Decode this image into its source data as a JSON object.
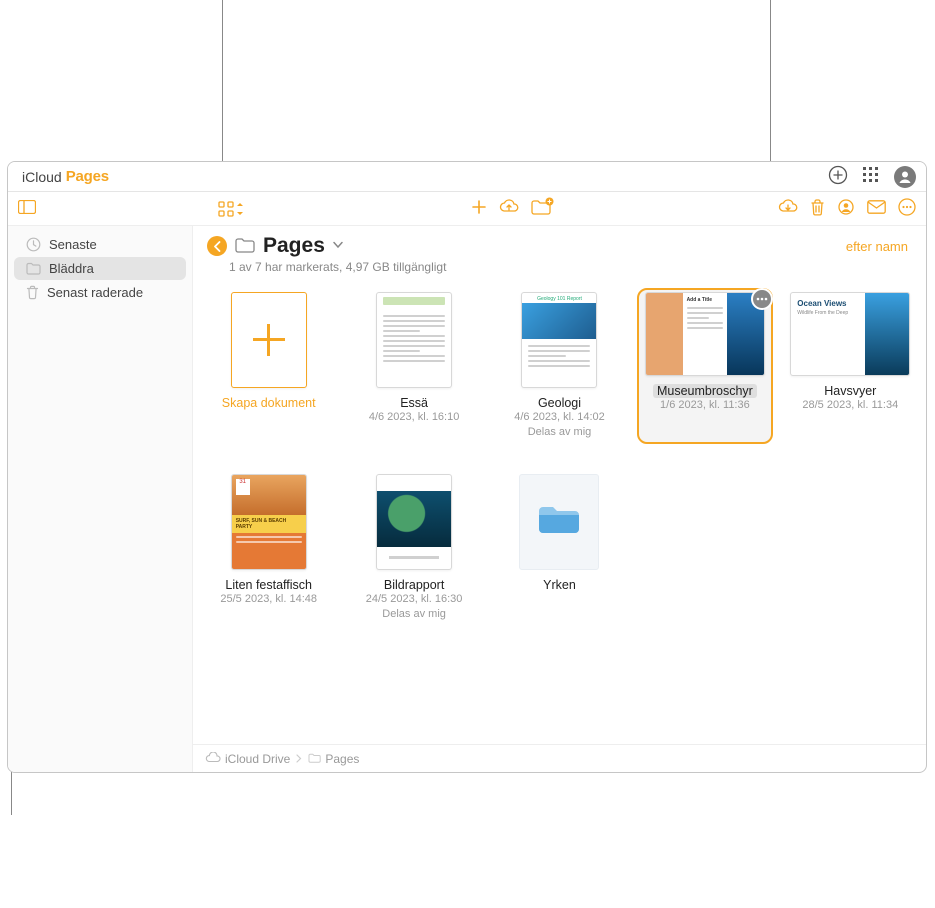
{
  "brand": {
    "icloud": "iCloud",
    "pages": "Pages"
  },
  "sidebar": {
    "items": [
      {
        "label": "Senaste"
      },
      {
        "label": "Bläddra"
      },
      {
        "label": "Senast raderade"
      }
    ]
  },
  "location": {
    "title": "Pages",
    "status": "1 av 7 har markerats, 4,97 GB tillgängligt",
    "sort_label": "efter namn"
  },
  "tiles": {
    "create": {
      "label": "Skapa dokument"
    },
    "essay": {
      "name": "Essä",
      "meta1": "4/6 2023, kl. 16:10"
    },
    "geology": {
      "name": "Geologi",
      "meta1": "4/6 2023, kl. 14:02",
      "meta2": "Delas av mig"
    },
    "brochure": {
      "name": "Museumbroschyr",
      "meta1": "1/6 2023, kl. 11:36"
    },
    "ocean": {
      "name": "Havsvyer",
      "meta1": "28/5 2023, kl. 11:34",
      "thumb_title": "Ocean Views",
      "thumb_sub": "Wildlife From the Deep"
    },
    "party": {
      "name": "Liten festaffisch",
      "meta1": "25/5 2023, kl. 14:48",
      "date_num": "31",
      "mid_text": "SURF, SUN & BEACH PARTY"
    },
    "report": {
      "name": "Bildrapport",
      "meta1": "24/5 2023, kl. 16:30",
      "meta2": "Delas av mig"
    },
    "folder": {
      "name": "Yrken"
    }
  },
  "breadcrumbs": {
    "root": "iCloud Drive",
    "leaf": "Pages"
  }
}
